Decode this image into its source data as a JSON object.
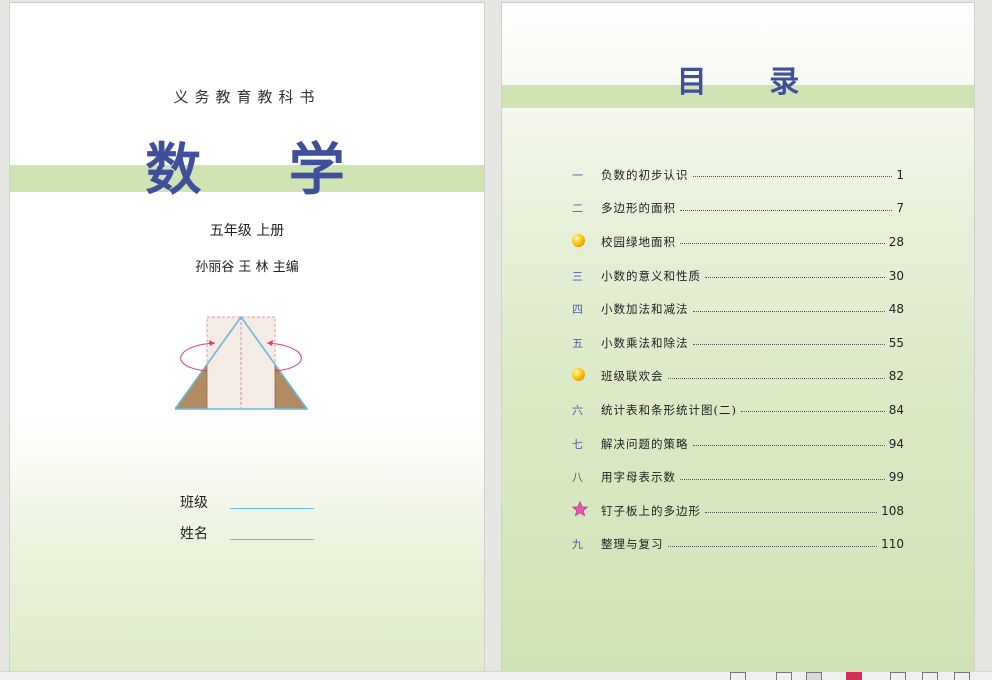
{
  "cover": {
    "series": "义务教育教科书",
    "subject": "数 学",
    "grade": "五年级  上册",
    "editors": "孙丽谷  王  林  主编",
    "class_label": "班级",
    "name_label": "姓名"
  },
  "toc": {
    "title": "目 录",
    "items": [
      {
        "mark": "一",
        "title": "负数的初步认识",
        "page": "1"
      },
      {
        "mark": "二",
        "title": "多边形的面积",
        "page": "7"
      },
      {
        "mark": "",
        "icon": "gold-ball-icon",
        "title": "校园绿地面积",
        "page": "28"
      },
      {
        "mark": "三",
        "title": "小数的意义和性质",
        "page": "30"
      },
      {
        "mark": "四",
        "title": "小数加法和减法",
        "page": "48"
      },
      {
        "mark": "五",
        "title": "小数乘法和除法",
        "page": "55"
      },
      {
        "mark": "",
        "icon": "gold-ball-icon",
        "title": "班级联欢会",
        "page": "82"
      },
      {
        "mark": "六",
        "title": "统计表和条形统计图(二)",
        "page": "84"
      },
      {
        "mark": "七",
        "title": "解决问题的策略",
        "page": "94"
      },
      {
        "mark": "八",
        "title": "用字母表示数",
        "page": "99"
      },
      {
        "mark": "",
        "icon": "pink-star-icon",
        "title": "钉子板上的多边形",
        "page": "108"
      },
      {
        "mark": "九",
        "title": "整理与复习",
        "page": "110"
      }
    ]
  },
  "colors": {
    "band": "#cfe3b3",
    "title": "#3e4f9c",
    "underline": "#59c1e6"
  }
}
